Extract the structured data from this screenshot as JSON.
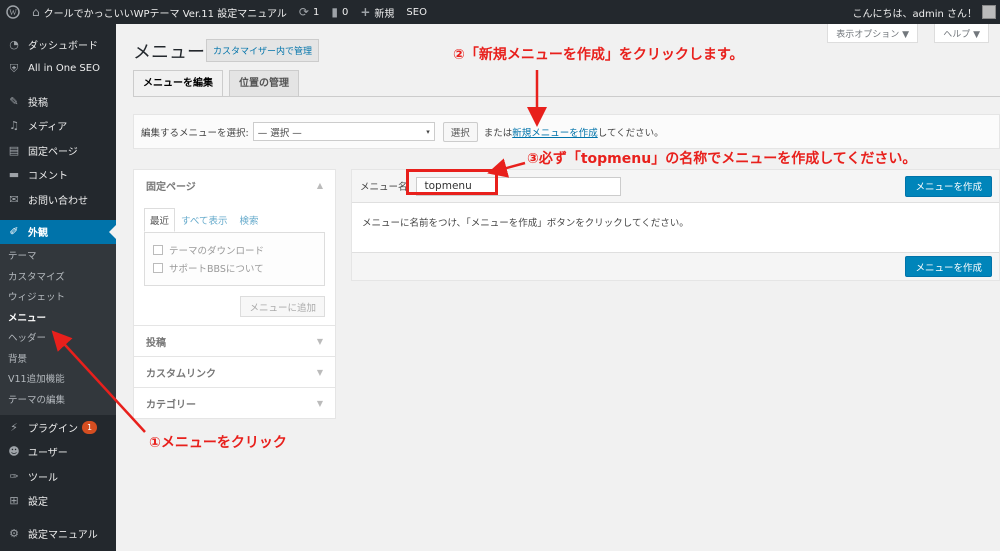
{
  "admin_bar": {
    "site_name": "クールでかっこいいWPテーマ Ver.11 設定マニュアル",
    "updates_count": "1",
    "comments_count": "0",
    "new_label": "新規",
    "seo_label": "SEO",
    "greeting": "こんにちは、admin さん！"
  },
  "sidebar": {
    "items_top": [
      {
        "label": "ダッシュボード",
        "icon": "dashboard-icon"
      },
      {
        "label": "All in One SEO",
        "icon": "shield-icon"
      }
    ],
    "items_mid": [
      {
        "label": "投稿",
        "icon": "pin-icon"
      },
      {
        "label": "メディア",
        "icon": "media-icon"
      },
      {
        "label": "固定ページ",
        "icon": "page-icon"
      },
      {
        "label": "コメント",
        "icon": "comment-icon"
      },
      {
        "label": "お問い合わせ",
        "icon": "mail-icon"
      }
    ],
    "current": {
      "label": "外観",
      "icon": "brush-icon"
    },
    "submenu": [
      "テーマ",
      "カスタマイズ",
      "ウィジェット",
      "メニュー",
      "ヘッダー",
      "背景",
      "V11追加機能",
      "テーマの編集"
    ],
    "plugins": {
      "label": "プラグイン",
      "badge": "1",
      "icon": "plugin-icon"
    },
    "items_bottom": [
      {
        "label": "ユーザー",
        "icon": "user-icon"
      },
      {
        "label": "ツール",
        "icon": "wrench-icon"
      },
      {
        "label": "設定",
        "icon": "settings-icon"
      }
    ],
    "manual": {
      "label": "設定マニュアル",
      "icon": "gear-icon"
    }
  },
  "header": {
    "title": "メニュー",
    "customizer_link": "カスタマイザー内で管理",
    "screen_options": "表示オプション ▼",
    "help": "ヘルプ ▼"
  },
  "tabs": [
    {
      "label": "メニューを編集",
      "active": true
    },
    {
      "label": "位置の管理",
      "active": false
    }
  ],
  "manage": {
    "prompt": "編集するメニューを選択:",
    "select_value": "— 選択 —",
    "select_button": "選択",
    "or_text": "または",
    "new_menu_link": "新規メニューを作成",
    "suffix_text": "してください。"
  },
  "left_panel": {
    "pages_header": "固定ページ",
    "inner_tabs": [
      "最近",
      "すべて表示",
      "検索"
    ],
    "pages": [
      "テーマのダウンロード",
      "サポートBBSについて"
    ],
    "add_button": "メニューに追加",
    "sections": [
      "投稿",
      "カスタムリンク",
      "カテゴリー"
    ]
  },
  "menu_editor": {
    "name_label": "メニュー名",
    "name_value": "topmenu",
    "create_button": "メニューを作成",
    "instructions": "メニューに名前をつけ、「メニューを作成」ボタンをクリックしてください。",
    "create_button_bottom": "メニューを作成"
  },
  "annotations": {
    "step1": "①メニューをクリック",
    "step2": "②「新規メニューを作成」をクリックします。",
    "step3": "③必ず「topmenu」の名称でメニューを作成してください。",
    "color": "#e8201c"
  }
}
